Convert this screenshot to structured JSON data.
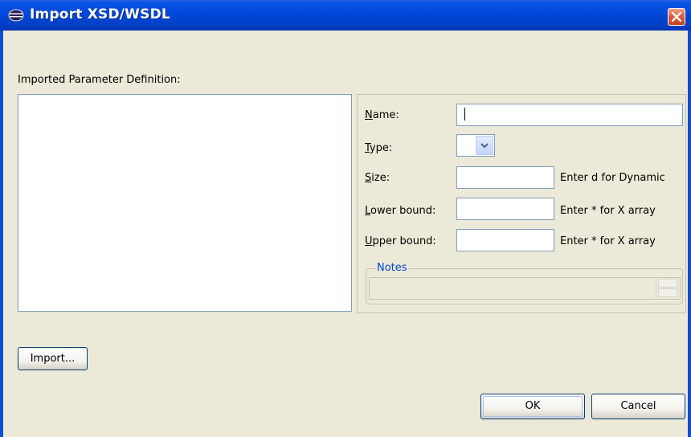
{
  "window": {
    "title": "Import XSD/WSDL",
    "icon": "eclipse-icon",
    "close_icon": "close-icon"
  },
  "left_panel": {
    "label": "Imported Parameter Definition:"
  },
  "form": {
    "name_label": "Name:",
    "name_value": "",
    "type_label": "Type:",
    "type_value": "",
    "size_label": "Size:",
    "size_value": "",
    "size_hint": "Enter d for Dynamic",
    "lower_label": "Lower bound:",
    "lower_value": "",
    "lower_hint": "Enter * for X array",
    "upper_label": "Upper bound:",
    "upper_value": "",
    "upper_hint": "Enter * for X array",
    "notes_label": "Notes"
  },
  "buttons": {
    "import_label": "Import...",
    "ok_label": "OK",
    "cancel_label": "Cancel"
  }
}
